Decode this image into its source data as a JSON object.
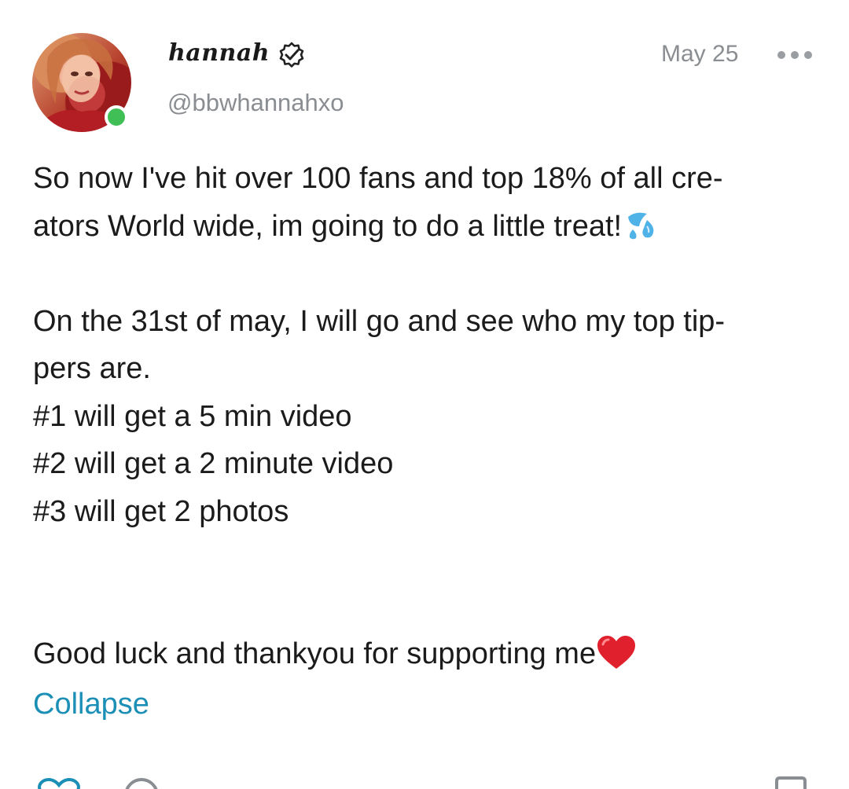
{
  "post": {
    "author": {
      "display_name": "hannah",
      "username": "@bbwhannahxo",
      "verified": true,
      "online": true
    },
    "date": "May 25",
    "body_lines": [
      "So now I've hit over 100 fans and top 18% of all cre-",
      "ators World wide, im going to do a little treat!",
      "",
      "On the 31st of may, I will go and see who my top tip-",
      "pers are.",
      "#1 will get a 5 min video",
      "#2 will get a 2 minute video",
      "#3 will get 2 photos",
      "",
      "",
      "Good luck and thankyou for supporting me"
    ],
    "collapse_label": "Collapse"
  },
  "colors": {
    "link": "#1c8fb6",
    "muted_text": "#8a8d91",
    "online_dot": "#3fbf55",
    "heart": "#e0202c",
    "sweat_drops": "#4fb3e8"
  },
  "icons": {
    "verified": "verified-badge-icon",
    "more": "more-options-icon",
    "sweat": "sweat-droplets-emoji",
    "heart": "red-heart-emoji",
    "like": "heart-outline-icon",
    "comment": "comment-bubble-icon",
    "bookmark": "bookmark-icon"
  }
}
